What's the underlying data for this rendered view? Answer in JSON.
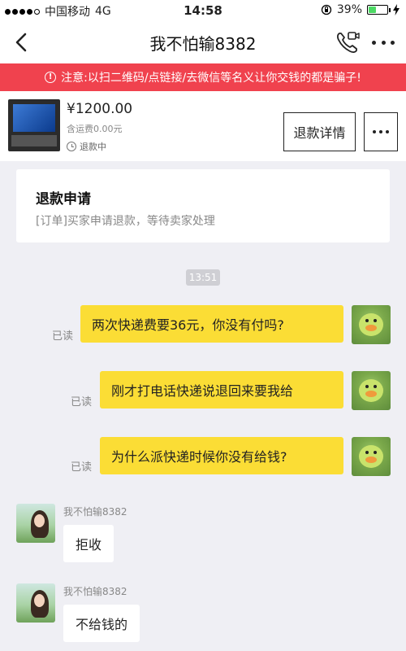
{
  "status_bar": {
    "carrier": "中国移动",
    "network": "4G",
    "time": "14:58",
    "battery": "39%",
    "battery_level": 0.39
  },
  "nav": {
    "title": "我不怕输8382"
  },
  "warning": {
    "text": "注意:以扫二维码/点链接/去微信等名义让你交钱的都是骗子!",
    "icon": "!"
  },
  "product": {
    "price": "¥1200.00",
    "shipping": "含运费0.00元",
    "status": "退款中",
    "refund_detail_label": "退款详情"
  },
  "refund_card": {
    "title": "退款申请",
    "subtitle": "[订单]买家申请退款，等待卖家处理"
  },
  "chat": {
    "timestamp": "13:51",
    "read_label": "已读",
    "sender_name": "我不怕输8382",
    "outgoing": [
      "两次快递费要36元，你没有付吗?",
      "刚才打电话快递说退回来要我给",
      "为什么派快递时候你没有给钱?"
    ],
    "incoming": [
      "拒收",
      "不给钱的"
    ]
  },
  "colors": {
    "warning_bg": "#f0424e",
    "bubble_out": "#fbdd35",
    "background": "#efeff4"
  }
}
